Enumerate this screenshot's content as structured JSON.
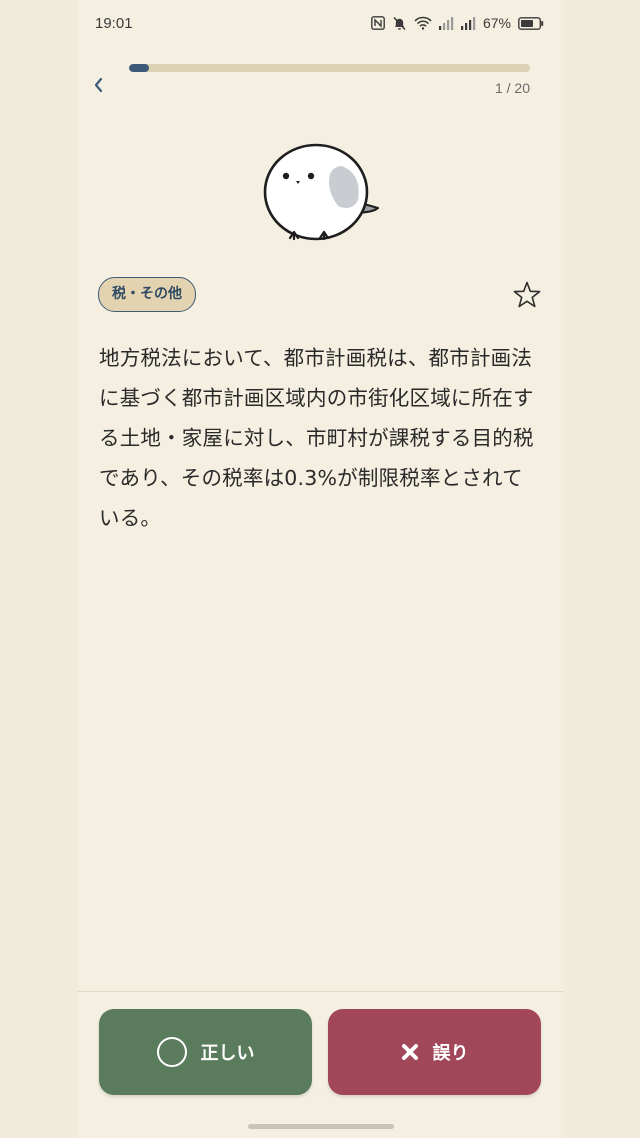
{
  "status_bar": {
    "time": "19:01",
    "battery": "67%"
  },
  "header": {
    "progress_text": "1 / 20",
    "progress_fraction": 0.05
  },
  "question": {
    "category": "税・その他",
    "text": "地方税法において、都市計画税は、都市計画法に基づく都市計画区域内の市街化区域に所在する土地・家屋に対し、市町村が課税する目的税であり、その税率は0.3%が制限税率とされている。"
  },
  "actions": {
    "true_label": "正しい",
    "false_label": "誤り"
  },
  "colors": {
    "accent": "#3d5a78",
    "true_button": "#5b7c5c",
    "false_button": "#a24659",
    "background": "#f4efe1"
  }
}
